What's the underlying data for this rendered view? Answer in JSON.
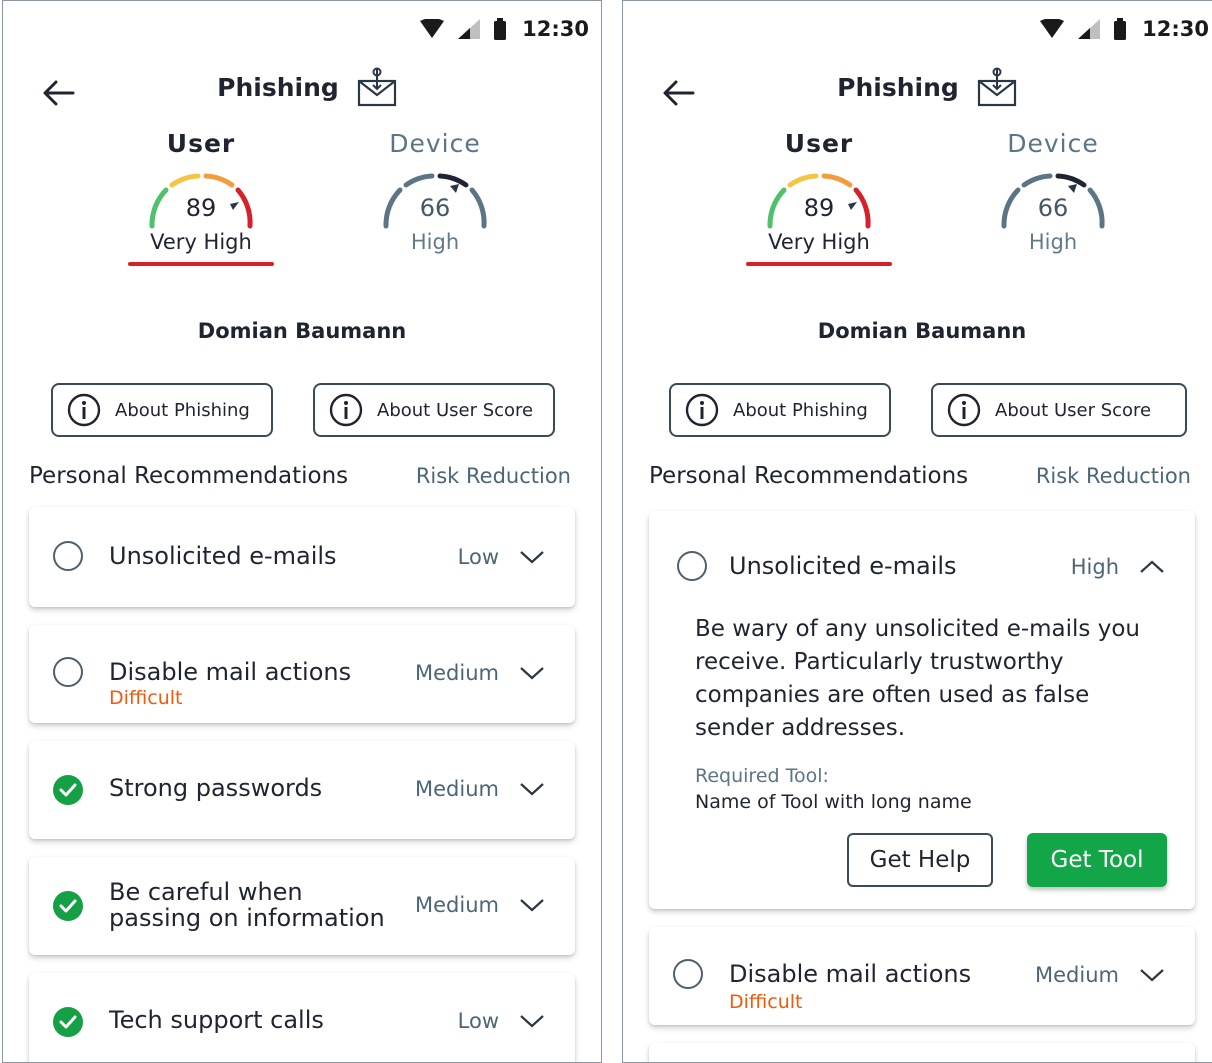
{
  "status_bar": {
    "time": "12:30"
  },
  "header": {
    "title": "Phishing",
    "icon": "phishing-mail-icon"
  },
  "tabs": {
    "user": {
      "label": "User",
      "score": "89",
      "level": "Very High",
      "score_fraction": 0.89
    },
    "device": {
      "label": "Device",
      "score": "66",
      "level": "High",
      "score_fraction": 0.66
    }
  },
  "person": {
    "name": "Domian Baumann"
  },
  "buttons": {
    "about_phishing": "About Phishing",
    "about_score": "About User Score"
  },
  "section": {
    "title": "Personal Recommendations",
    "link": "Risk Reduction"
  },
  "left_items": [
    {
      "name": "Unsolicited e-mails",
      "reduction": "Low",
      "done": false
    },
    {
      "name": "Disable mail actions",
      "sub": "Difficult",
      "reduction": "Medium",
      "done": false
    },
    {
      "name": "Strong passwords",
      "reduction": "Medium",
      "done": true
    },
    {
      "name_line1": "Be careful when",
      "name_line2": "passing on information",
      "reduction": "Medium",
      "done": true
    },
    {
      "name": "Tech support calls",
      "reduction": "Low",
      "done": true
    }
  ],
  "right_items": [
    {
      "name": "Unsolicited e-mails",
      "reduction": "High",
      "expanded": true,
      "description": "Be wary of any unsolicited e-mails you receive. Particularly trustworthy companies are often used as false sender addresses.",
      "tool_label": "Required Tool:",
      "tool_name": "Name of Tool with long name",
      "help_button": "Get Help",
      "tool_button": "Get Tool"
    },
    {
      "name": "Disable mail actions",
      "sub": "Difficult",
      "reduction": "Medium",
      "done": false
    }
  ],
  "colors": {
    "accent_red": "#d6202a",
    "success_green": "#15a046",
    "warning_orange": "#ef5a0c",
    "muted_blue": "#4c6677"
  }
}
